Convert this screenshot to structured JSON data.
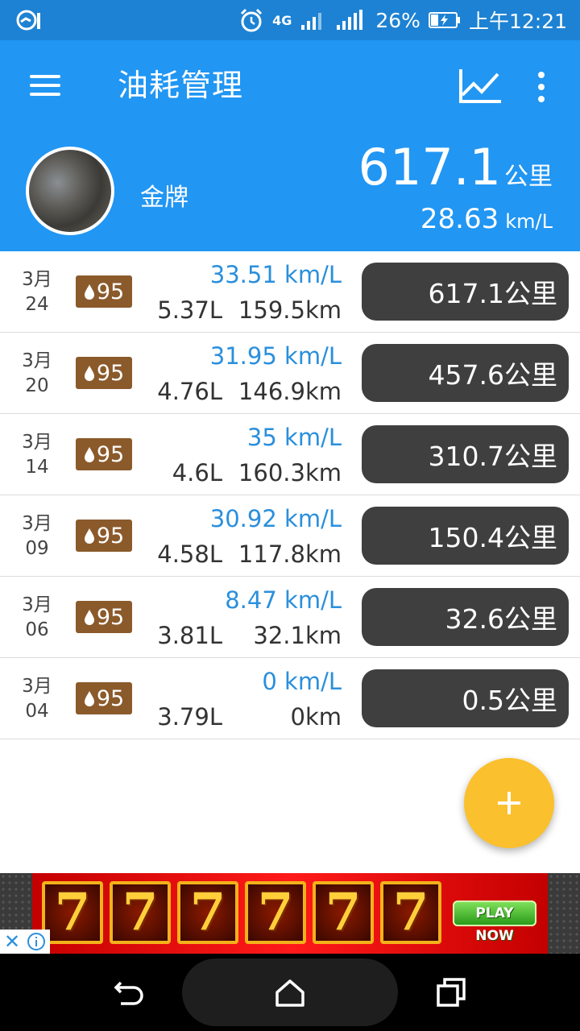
{
  "status_bar": {
    "network": "4G",
    "battery": "26%",
    "time": "上午12:21",
    "icons": [
      "notification-app-icon",
      "alarm-icon",
      "signal-icon",
      "signal-icon-2",
      "battery-icon"
    ]
  },
  "app_bar": {
    "title": "油耗管理",
    "icons": [
      "menu-icon",
      "chart-icon",
      "more-icon"
    ]
  },
  "summary": {
    "vehicle_name": "金牌",
    "total_distance": "617.1",
    "total_distance_unit": "公里",
    "avg_efficiency": "28.63",
    "avg_efficiency_unit": "km/L"
  },
  "records": [
    {
      "month": "3月",
      "day": "24",
      "grade": "95",
      "efficiency": "33.51 km/L",
      "liters": "5.37L",
      "distance": "159.5km",
      "odometer": "617.1公里"
    },
    {
      "month": "3月",
      "day": "20",
      "grade": "95",
      "efficiency": "31.95 km/L",
      "liters": "4.76L",
      "distance": "146.9km",
      "odometer": "457.6公里"
    },
    {
      "month": "3月",
      "day": "14",
      "grade": "95",
      "efficiency": "35 km/L",
      "liters": "4.6L",
      "distance": "160.3km",
      "odometer": "310.7公里"
    },
    {
      "month": "3月",
      "day": "09",
      "grade": "95",
      "efficiency": "30.92 km/L",
      "liters": "4.58L",
      "distance": "117.8km",
      "odometer": "150.4公里"
    },
    {
      "month": "3月",
      "day": "06",
      "grade": "95",
      "efficiency": "8.47 km/L",
      "liters": "3.81L",
      "distance": "32.1km",
      "odometer": "32.6公里"
    },
    {
      "month": "3月",
      "day": "04",
      "grade": "95",
      "efficiency": "0 km/L",
      "liters": "3.79L",
      "distance": "0km",
      "odometer": "0.5公里"
    }
  ],
  "fab": {
    "icon": "plus-icon"
  },
  "ad": {
    "reel_symbol": "7",
    "reels": [
      "7",
      "7",
      "7",
      "7",
      "7",
      "7"
    ],
    "cta": "PLAY NOW",
    "close": "✕"
  },
  "navbar": {
    "icons": [
      "back-icon",
      "home-icon",
      "recents-icon"
    ]
  },
  "colors": {
    "primary": "#2196f3",
    "status_bar": "#1d82d3",
    "accent": "#fbc02d",
    "efficiency_text": "#2a8fdc",
    "fuel_badge": "#8b5a2b",
    "odometer_chip": "#3f3f3f"
  }
}
